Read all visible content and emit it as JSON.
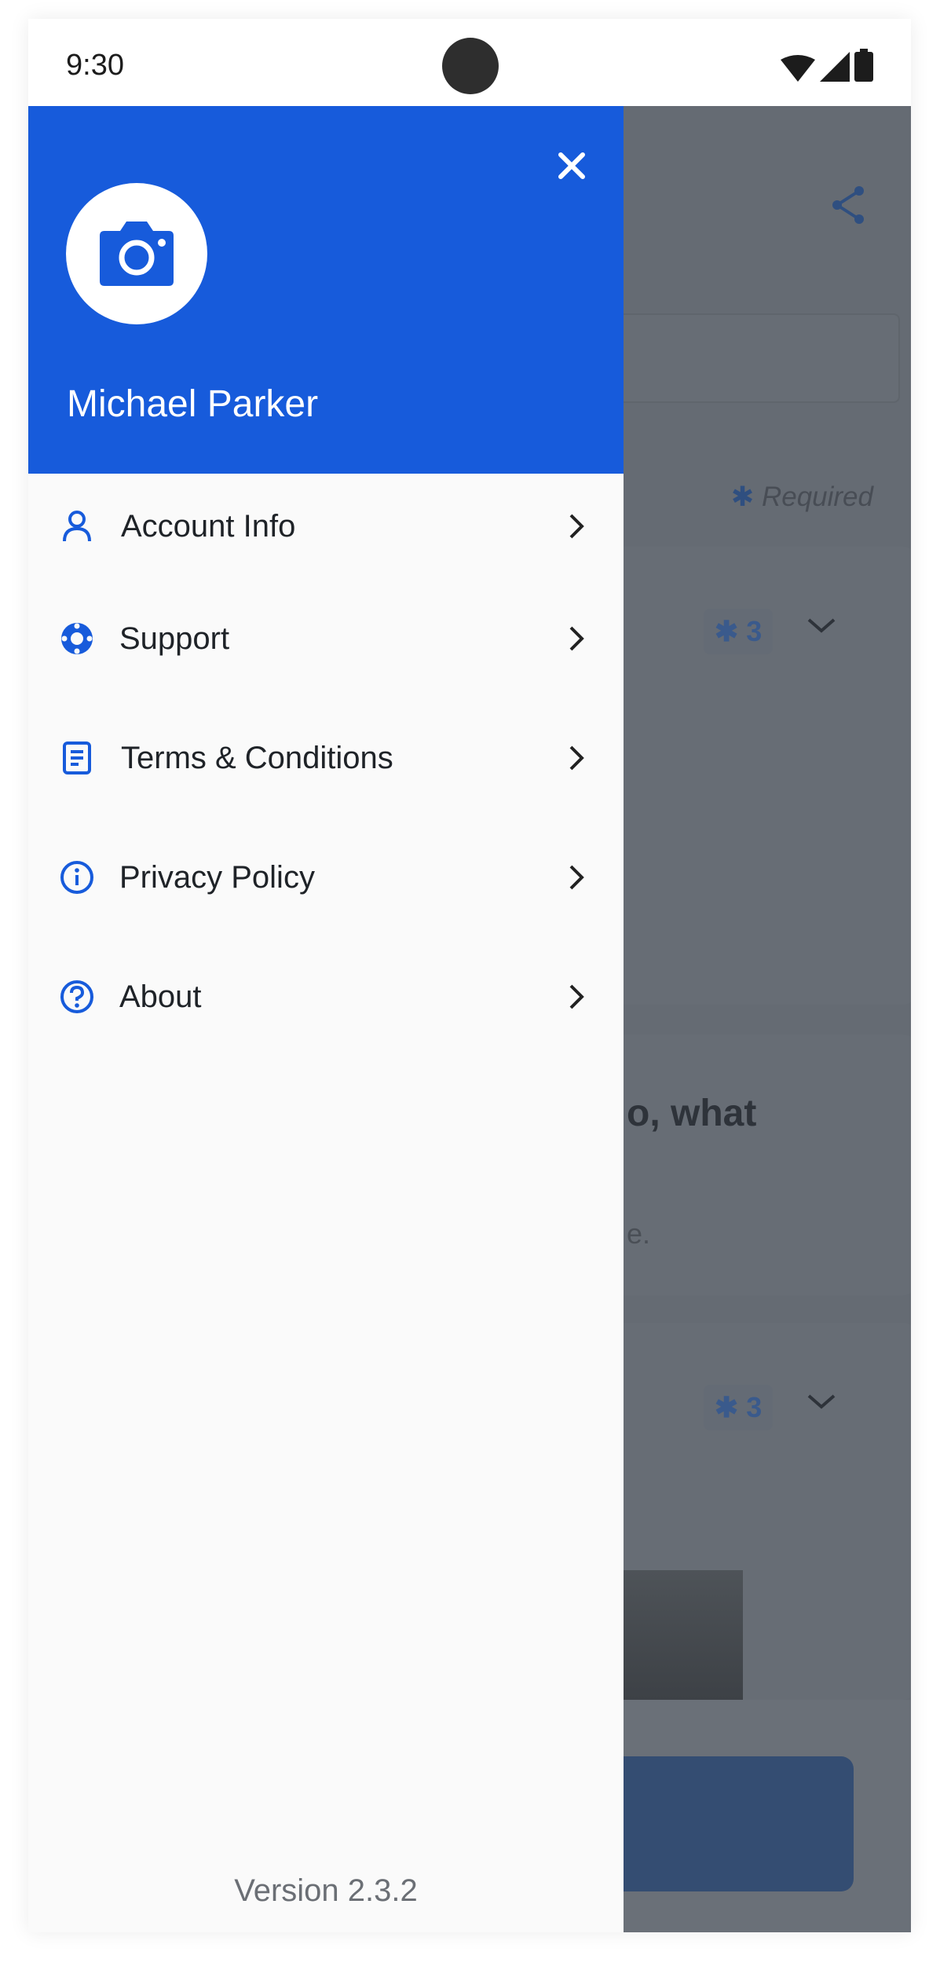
{
  "status_bar": {
    "time": "9:30",
    "icons": [
      "wifi-icon",
      "signal-icon",
      "battery-icon"
    ]
  },
  "background_screen": {
    "required_label": "Required",
    "required_marker": "✱",
    "cards": [
      {
        "badge": "3"
      },
      {
        "question_fragment": "o, what",
        "subtext_fragment": "e."
      },
      {
        "badge": "3"
      }
    ]
  },
  "drawer": {
    "user_name": "Michael Parker",
    "avatar_icon": "camera-icon",
    "close_icon": "close-icon",
    "menu": [
      {
        "label": "Account Info",
        "icon": "user-icon"
      },
      {
        "label": "Support",
        "icon": "lifebuoy-icon"
      },
      {
        "label": "Terms & Conditions",
        "icon": "document-icon"
      },
      {
        "label": "Privacy Policy",
        "icon": "info-icon"
      },
      {
        "label": "About",
        "icon": "help-icon"
      }
    ],
    "version": "Version 2.3.2"
  },
  "colors": {
    "accent": "#175bdb",
    "overlay": "#656b73",
    "text": "#1f2328"
  }
}
